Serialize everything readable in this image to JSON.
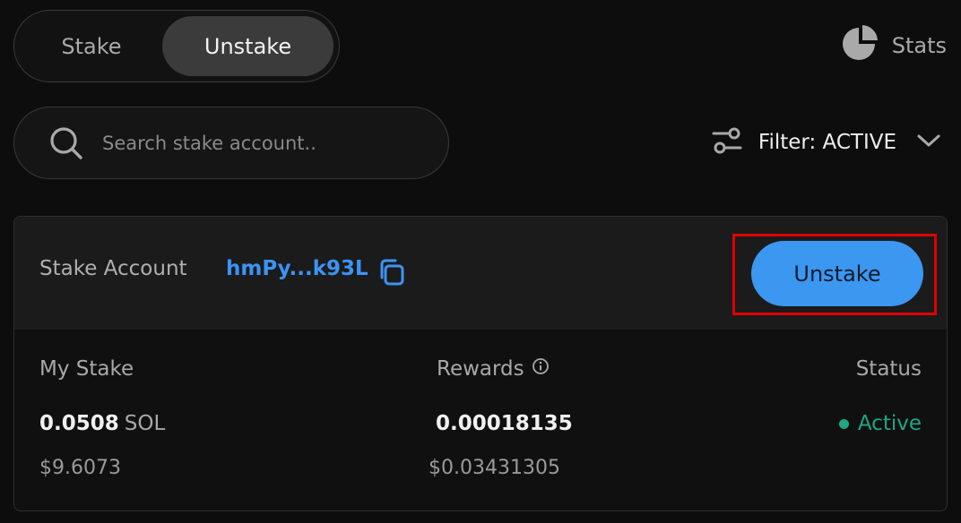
{
  "toggle": {
    "stake_label": "Stake",
    "unstake_label": "Unstake",
    "active": "Unstake"
  },
  "stats": {
    "label": "Stats",
    "icon": "pie-chart-icon"
  },
  "search": {
    "placeholder": "Search stake account..",
    "value": ""
  },
  "filter": {
    "label": "Filter: ACTIVE",
    "icon": "sliders-icon"
  },
  "account": {
    "label": "Stake Account",
    "address": "hmPy...k93L",
    "action_label": "Unstake"
  },
  "columns": {
    "my_stake": "My Stake",
    "rewards": "Rewards",
    "status": "Status"
  },
  "values": {
    "stake_amount": "0.0508",
    "stake_unit": "SOL",
    "stake_usd": "$9.6073",
    "rewards_amount": "0.00018135",
    "rewards_usd": "$0.03431305",
    "status": "Active"
  },
  "colors": {
    "accent": "#3b97f0",
    "address": "#3d93f5",
    "status_active": "#1fa584",
    "highlight": "#e00000"
  }
}
